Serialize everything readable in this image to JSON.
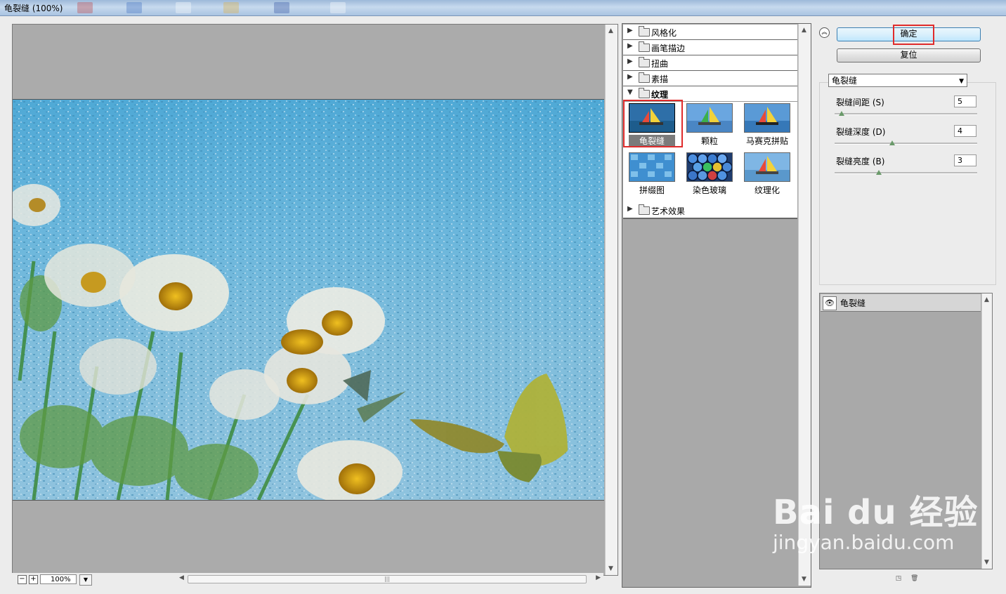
{
  "window": {
    "title": "龟裂缝 (100%)"
  },
  "preview": {
    "zoom_value": "100%",
    "zoom_out": "−",
    "zoom_in": "+",
    "scroll_grip": "|||"
  },
  "gallery": {
    "categories_top": [
      {
        "label": "风格化"
      },
      {
        "label": "画笔描边"
      },
      {
        "label": "扭曲"
      },
      {
        "label": "素描"
      }
    ],
    "open_category": {
      "label": "纹理"
    },
    "thumbs": [
      {
        "label": "龟裂缝",
        "selected": true
      },
      {
        "label": "颗粒"
      },
      {
        "label": "马赛克拼贴"
      },
      {
        "label": "拼缀图"
      },
      {
        "label": "染色玻璃"
      },
      {
        "label": "纹理化"
      }
    ],
    "categories_bottom": [
      {
        "label": "艺术效果"
      }
    ]
  },
  "buttons": {
    "ok": "确定",
    "reset": "复位"
  },
  "filter_select": {
    "value": "龟裂缝"
  },
  "params": [
    {
      "label": "裂缝间距 (S)",
      "value": "5",
      "fraction": 0.03
    },
    {
      "label": "裂缝深度 (D)",
      "value": "4",
      "fraction": 0.4
    },
    {
      "label": "裂缝亮度 (B)",
      "value": "3",
      "fraction": 0.3
    }
  ],
  "layers": [
    {
      "name": "龟裂缝"
    }
  ],
  "watermark": {
    "brand": "Bai du 经验",
    "url": "jingyan.baidu.com"
  },
  "colors": {
    "highlight": "#e02b2b",
    "sky": "#6cb7dc",
    "panel_gray": "#a9a9a9"
  }
}
